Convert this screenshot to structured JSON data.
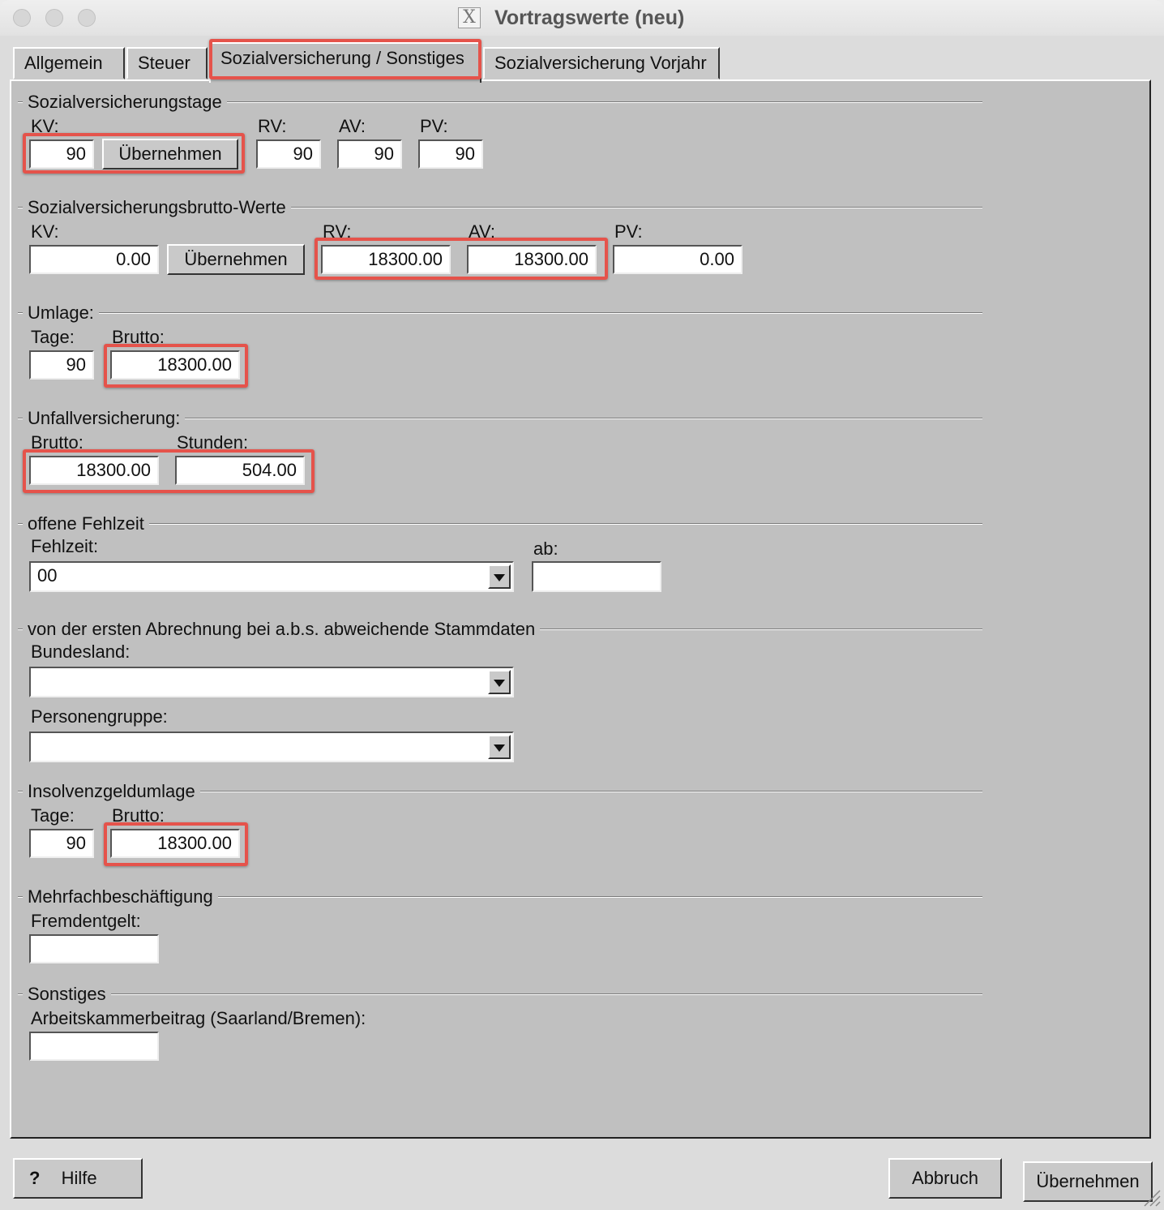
{
  "window": {
    "title": "Vortragswerte (neu)",
    "icon": "x-window-icon"
  },
  "tabs": [
    {
      "label": "Allgemein"
    },
    {
      "label": "Steuer"
    },
    {
      "label": "Sozialversicherung / Sonstiges"
    },
    {
      "label": "Sozialversicherung Vorjahr"
    }
  ],
  "sv_tage": {
    "title": "Sozialversicherungstage",
    "kv_label": "KV:",
    "kv_value": "90",
    "apply_label": "Übernehmen",
    "rv_label": "RV:",
    "rv_value": "90",
    "av_label": "AV:",
    "av_value": "90",
    "pv_label": "PV:",
    "pv_value": "90"
  },
  "sv_brutto": {
    "title": "Sozialversicherungsbrutto-Werte",
    "kv_label": "KV:",
    "kv_value": "0.00",
    "apply_label": "Übernehmen",
    "rv_label": "RV:",
    "rv_value": "18300.00",
    "av_label": "AV:",
    "av_value": "18300.00",
    "pv_label": "PV:",
    "pv_value": "0.00"
  },
  "umlage": {
    "title": "Umlage:",
    "tage_label": "Tage:",
    "tage_value": "90",
    "brutto_label": "Brutto:",
    "brutto_value": "18300.00"
  },
  "unfall": {
    "title": "Unfallversicherung:",
    "brutto_label": "Brutto:",
    "brutto_value": "18300.00",
    "stunden_label": "Stunden:",
    "stunden_value": "504.00"
  },
  "fehlzeit": {
    "title": "offene Fehlzeit",
    "fehlzeit_label": "Fehlzeit:",
    "fehlzeit_value": "00",
    "ab_label": "ab:",
    "ab_value": ""
  },
  "stammdaten": {
    "title": "von der ersten Abrechnung bei a.b.s. abweichende Stammdaten",
    "bundesland_label": "Bundesland:",
    "bundesland_value": "",
    "personengruppe_label": "Personengruppe:",
    "personengruppe_value": ""
  },
  "insolvenz": {
    "title": "Insolvenzgeldumlage",
    "tage_label": "Tage:",
    "tage_value": "90",
    "brutto_label": "Brutto:",
    "brutto_value": "18300.00"
  },
  "mehrfach": {
    "title": "Mehrfachbeschäftigung",
    "fremd_label": "Fremdentgelt:",
    "fremd_value": ""
  },
  "sonstiges": {
    "title": "Sonstiges",
    "akb_label": "Arbeitskammerbeitrag (Saarland/Bremen):",
    "akb_value": ""
  },
  "footer": {
    "help_icon": "?",
    "help_label": "Hilfe",
    "cancel_label": "Abbruch",
    "apply_label": "Übernehmen"
  },
  "colors": {
    "panel": "#c0c0c0",
    "highlight": "#e5534b"
  }
}
